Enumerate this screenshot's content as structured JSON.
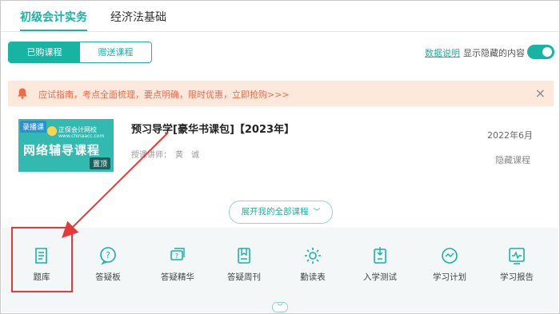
{
  "tabs": [
    {
      "label": "初级会计实务",
      "active": true
    },
    {
      "label": "经济法基础",
      "active": false
    }
  ],
  "segment": {
    "purchased": "已购课程",
    "gifted": "赠送课程"
  },
  "data_note_link": "数据说明",
  "show_hidden_label": "显示隐藏的内容",
  "show_hidden_on": true,
  "notice": {
    "text": "应试指南，考点全面梳理，要点明确，限时优惠，立即抢购>>>",
    "close": "×"
  },
  "course": {
    "thumb": {
      "tag": "录播课",
      "brand": "正保会计网校",
      "url": "www.chinaacc.com",
      "title": "网络辅导课程",
      "pin": "置顶"
    },
    "title": "预习导学[豪华书课包]【2023年】",
    "teacher_label": "授课讲师：",
    "teacher_name": "黄　诚",
    "date": "2022年6月",
    "status": "隐藏课程"
  },
  "expand_label": "展开我的全部课程",
  "tools": [
    {
      "label": "题库",
      "icon": "question-bank-icon"
    },
    {
      "label": "答疑板",
      "icon": "qa-board-icon"
    },
    {
      "label": "答疑精华",
      "icon": "qa-highlights-icon"
    },
    {
      "label": "答疑周刊",
      "icon": "qa-weekly-icon"
    },
    {
      "label": "勤读表",
      "icon": "reading-table-icon"
    },
    {
      "label": "入学测试",
      "icon": "entrance-test-icon"
    },
    {
      "label": "学习计划",
      "icon": "study-plan-icon"
    },
    {
      "label": "学习报告",
      "icon": "study-report-icon"
    }
  ],
  "colors": {
    "accent": "#17b3a3",
    "notice_bg": "#fde8dc",
    "notice_text": "#f06a4a",
    "annotation": "#e63a3a"
  }
}
